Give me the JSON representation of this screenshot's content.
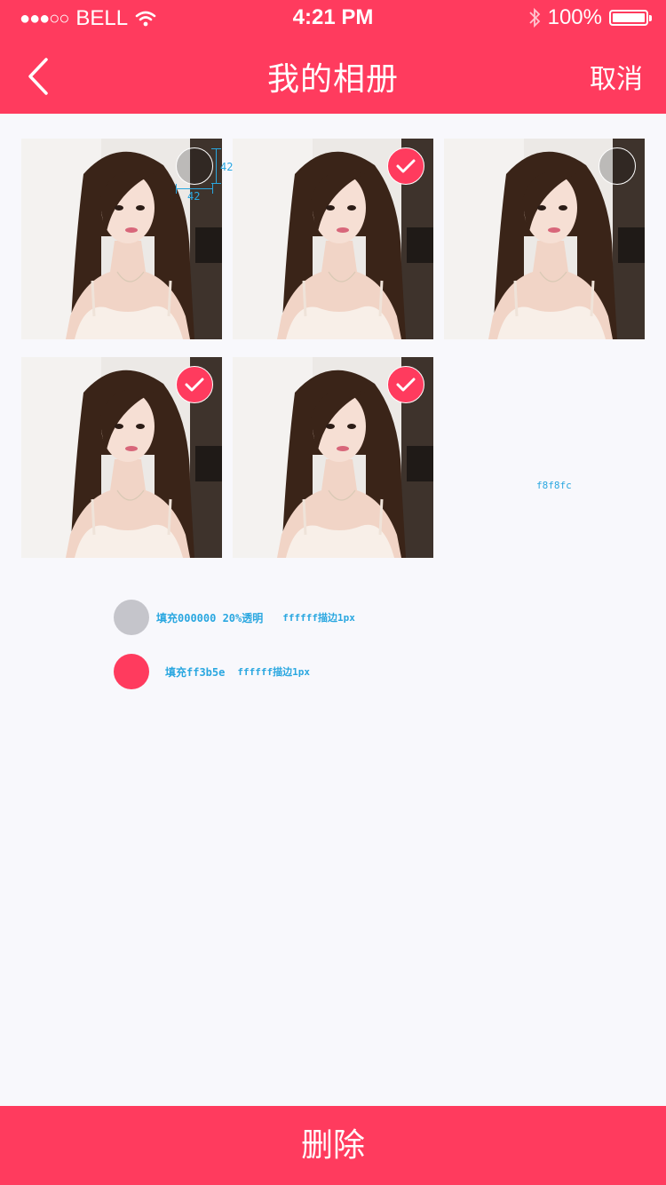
{
  "status_bar": {
    "signal": "●●●○○",
    "carrier": "BELL",
    "time": "4:21 PM",
    "battery": "100%"
  },
  "nav": {
    "title": "我的相册",
    "cancel": "取消"
  },
  "photos": [
    {
      "selected": false
    },
    {
      "selected": true
    },
    {
      "selected": false
    },
    {
      "selected": true
    },
    {
      "selected": true
    }
  ],
  "annotations": {
    "size_h": "42",
    "size_w": "42",
    "bg_color": "f8f8fc",
    "unselected_fill": "填充000000 20%透明",
    "unselected_stroke": "ffffff描边1px",
    "selected_fill": "填充ff3b5e",
    "selected_stroke": "ffffff描边1px"
  },
  "delete_button": "删除",
  "colors": {
    "accent": "#ff3b5e",
    "background": "#f8f8fc",
    "annotation": "#2aa7e0"
  }
}
